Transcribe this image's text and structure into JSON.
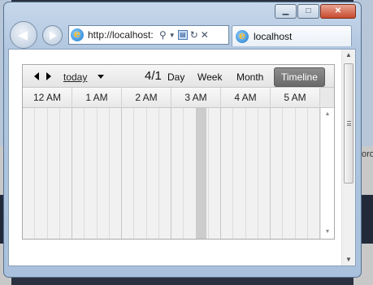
{
  "browser": {
    "address": "http://localhost:",
    "tab_title": "localhost",
    "minimize_glyph": "▁",
    "maximize_glyph": "□",
    "close_glyph": "✕"
  },
  "background": {
    "right_edge_text": "oro"
  },
  "scheduler": {
    "today_label": "today",
    "date_label": "4/1",
    "views": [
      "Day",
      "Week",
      "Month",
      "Timeline"
    ],
    "active_view": "Timeline",
    "hours": [
      "12 AM",
      "1 AM",
      "2 AM",
      "3 AM",
      "4 AM",
      "5 AM"
    ],
    "slots_per_hour": 4
  },
  "colors": {
    "active_view_bg": "#7a7a7a",
    "grid_bg": "#f1f1f1",
    "now_band": "#cccccc"
  }
}
